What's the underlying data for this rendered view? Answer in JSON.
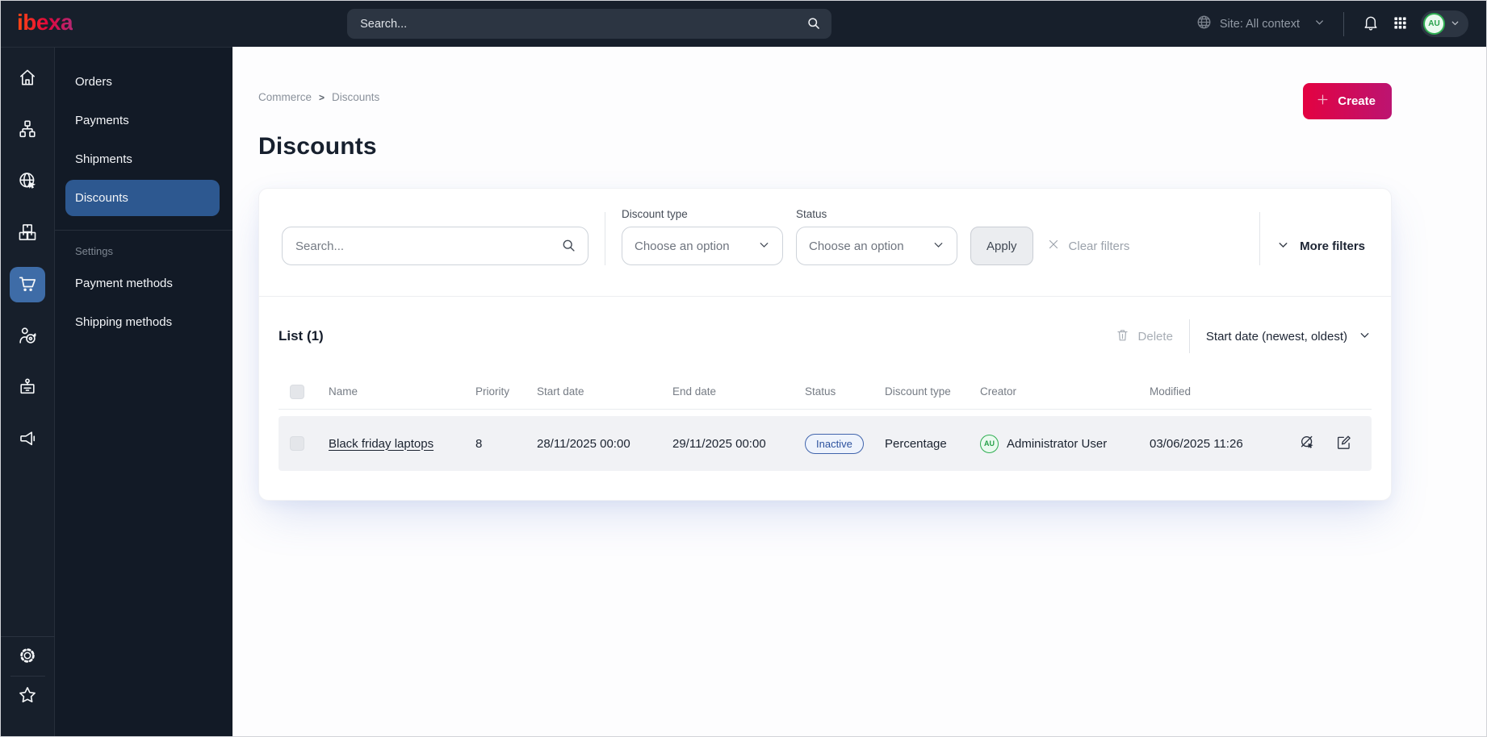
{
  "topbar": {
    "logo_text": "ibexa",
    "search_placeholder": "Search...",
    "site_context_label": "Site: All context",
    "user_initials": "AU"
  },
  "sidebar": {
    "rail_icons": [
      "home",
      "content-tree",
      "site",
      "products",
      "commerce",
      "customers",
      "corporate",
      "marketing",
      "settings",
      "bookmarks"
    ],
    "menu": {
      "items": [
        {
          "label": "Orders",
          "active": false
        },
        {
          "label": "Payments",
          "active": false
        },
        {
          "label": "Shipments",
          "active": false
        },
        {
          "label": "Discounts",
          "active": true
        }
      ],
      "section_label": "Settings",
      "settings_items": [
        {
          "label": "Payment methods"
        },
        {
          "label": "Shipping methods"
        }
      ]
    }
  },
  "main": {
    "breadcrumb": {
      "items": [
        "Commerce",
        "Discounts"
      ],
      "separator": ">"
    },
    "create_label": "Create",
    "page_title": "Discounts",
    "filters": {
      "search_placeholder": "Search...",
      "discount_type_label": "Discount type",
      "discount_type_value": "Choose an option",
      "status_label": "Status",
      "status_value": "Choose an option",
      "apply_label": "Apply",
      "clear_label": "Clear filters",
      "more_filters_label": "More filters"
    },
    "list": {
      "title": "List (1)",
      "delete_label": "Delete",
      "sort_label": "Start date (newest, oldest)",
      "columns": [
        "Name",
        "Priority",
        "Start date",
        "End date",
        "Status",
        "Discount type",
        "Creator",
        "Modified"
      ],
      "rows": [
        {
          "name": "Black friday laptops",
          "priority": "8",
          "start_date": "28/11/2025 00:00",
          "end_date": "29/11/2025 00:00",
          "status": "Inactive",
          "discount_type": "Percentage",
          "creator_initials": "AU",
          "creator": "Administrator User",
          "modified": "03/06/2025 11:26"
        }
      ]
    }
  },
  "colors": {
    "brand_gradient_start": "#ff4713",
    "brand_gradient_end": "#b42873",
    "create_gradient_start": "#e30241",
    "create_gradient_end": "#bc1471",
    "active_nav_blue": "#2d5890",
    "status_inactive_blue": "#2d529e",
    "avatar_green": "#2fae52",
    "dark_chrome": "#171f2b"
  }
}
